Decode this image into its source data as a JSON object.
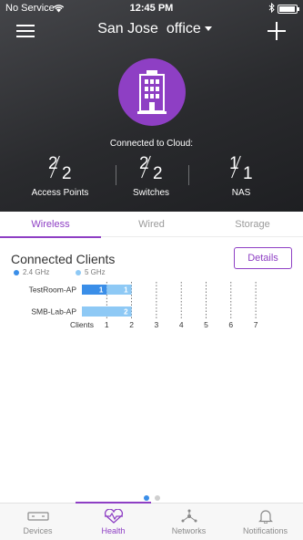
{
  "status_bar": {
    "carrier": "No Service",
    "time": "12:45 PM"
  },
  "header": {
    "site_name": "San Jose  office"
  },
  "cloud": {
    "label": "Connected to Cloud:"
  },
  "stats": [
    {
      "num": "2",
      "den": "2",
      "label": "Access Points"
    },
    {
      "num": "2",
      "den": "2",
      "label": "Switches"
    },
    {
      "num": "1",
      "den": "1",
      "label": "NAS"
    }
  ],
  "tabs": [
    {
      "label": "Wireless",
      "active": true
    },
    {
      "label": "Wired",
      "active": false
    },
    {
      "label": "Storage",
      "active": false
    }
  ],
  "clients": {
    "title": "Connected Clients",
    "details_label": "Details"
  },
  "legend": [
    {
      "label": "2.4 GHz",
      "color": "#3a8ee8"
    },
    {
      "label": "5 GHz",
      "color": "#8ec9f5"
    }
  ],
  "colors": {
    "accent": "#8e3fc4",
    "ghz24": "#3a8ee8",
    "ghz5": "#8ec9f5"
  },
  "chart_data": {
    "type": "bar",
    "orientation": "horizontal",
    "stacked": true,
    "categories": [
      "TestRoom-AP",
      "SMB-Lab-AP"
    ],
    "series": [
      {
        "name": "2.4 GHz",
        "values": [
          1,
          0
        ]
      },
      {
        "name": "5 GHz",
        "values": [
          1,
          2
        ]
      }
    ],
    "xlabel": "Clients",
    "xticks": [
      1,
      2,
      3,
      4,
      5,
      6,
      7
    ],
    "xlim": [
      0,
      7
    ],
    "grid": "vertical dotted"
  },
  "pager": {
    "count": 2,
    "active": 0
  },
  "bottom_nav": [
    {
      "label": "Devices",
      "icon": "devices-icon",
      "active": false
    },
    {
      "label": "Health",
      "icon": "health-icon",
      "active": true
    },
    {
      "label": "Networks",
      "icon": "networks-icon",
      "active": false
    },
    {
      "label": "Notifications",
      "icon": "bell-icon",
      "active": false
    }
  ]
}
